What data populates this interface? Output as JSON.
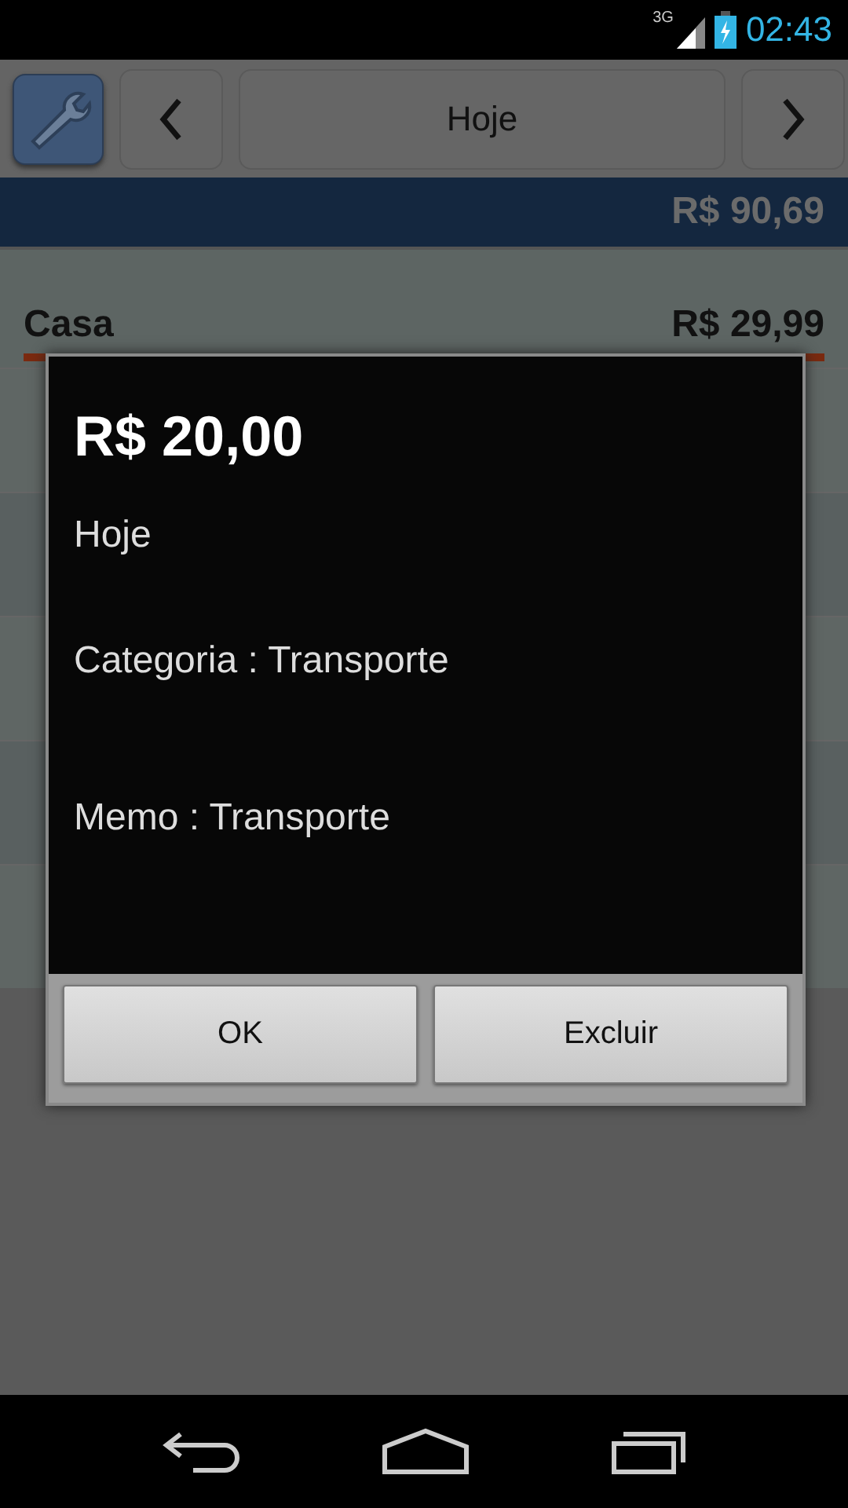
{
  "status_bar": {
    "network": "3G",
    "time": "02:43"
  },
  "toolbar": {
    "title": "Hoje"
  },
  "total": "R$ 90,69",
  "categories": [
    {
      "name": "Casa",
      "amount": "R$ 29,99",
      "level": 1.0
    }
  ],
  "dialog": {
    "amount": "R$ 20,00",
    "lines": [
      "Hoje",
      "Categoria : Transporte",
      "Memo : Transporte"
    ],
    "buttons": [
      "OK",
      "Excluir"
    ]
  }
}
